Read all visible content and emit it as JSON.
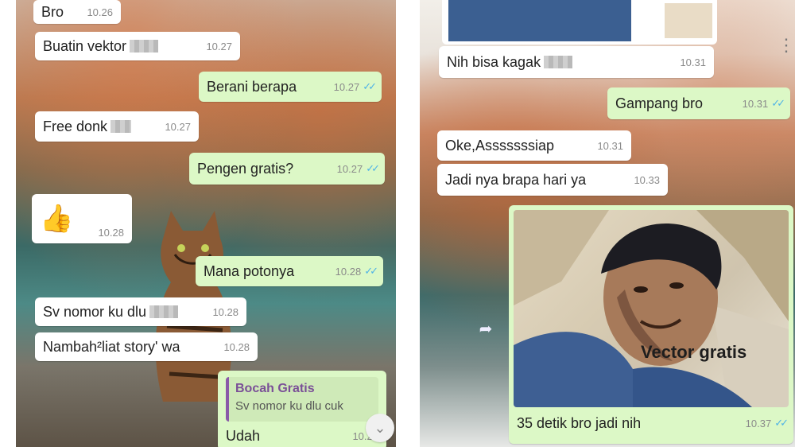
{
  "left_chat": {
    "messages": [
      {
        "text": "Bro",
        "time": "10.26",
        "dir": "in"
      },
      {
        "text": "Buatin vektor",
        "time": "10.27",
        "dir": "in"
      },
      {
        "text": "Berani berapa",
        "time": "10.27",
        "dir": "out"
      },
      {
        "text": "Free donk",
        "time": "10.27",
        "dir": "in"
      },
      {
        "text": "Pengen gratis?",
        "time": "10.27",
        "dir": "out"
      },
      {
        "text": "👍",
        "time": "10.28",
        "dir": "in"
      },
      {
        "text": "Mana potonya",
        "time": "10.28",
        "dir": "out"
      },
      {
        "text": "Sv nomor ku dlu",
        "time": "10.28",
        "dir": "in"
      },
      {
        "text": "Nambah²liat story' wa",
        "time": "10.28",
        "dir": "in"
      }
    ],
    "reply": {
      "quoted_name": "Bocah Gratis",
      "quoted_text": "Sv nomor ku dlu cuk",
      "text": "Udah",
      "time": "10.29"
    },
    "scroll_icon": "double-chevron-down-icon"
  },
  "right_chat": {
    "messages": [
      {
        "text": "Nih bisa kagak",
        "time": "10.31",
        "dir": "in"
      },
      {
        "text": "Gampang bro",
        "time": "10.31",
        "dir": "out"
      },
      {
        "text": "Oke,Asssssssiap",
        "time": "10.31",
        "dir": "in"
      },
      {
        "text": "Jadi nya brapa hari ya",
        "time": "10.33",
        "dir": "in"
      }
    ],
    "image_message": {
      "watermark": "Vector gratis",
      "caption": "35 detik bro jadi nih",
      "time": "10.37"
    },
    "menu_icon": "vertical-dots-icon",
    "forward_icon": "forward-arrow-icon"
  },
  "colors": {
    "outgoing": "#dcf8c6",
    "incoming": "#ffffff",
    "read_ticks": "#4fb3e6",
    "quote_accent": "#8a5aa8"
  },
  "ticks_glyph": "✓✓"
}
